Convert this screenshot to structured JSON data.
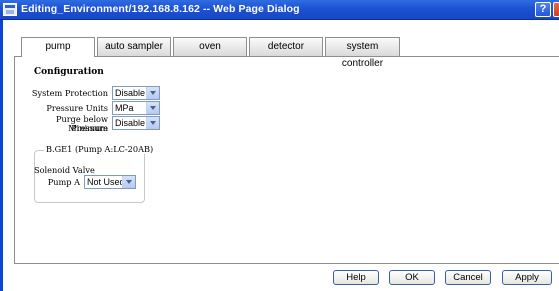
{
  "window": {
    "title": "Editing_Environment/192.168.8.162 -- Web Page Dialog",
    "help_glyph": "?"
  },
  "tabs": [
    {
      "label": "pump",
      "active": true
    },
    {
      "label": "auto sampler",
      "active": false
    },
    {
      "label": "oven",
      "active": false
    },
    {
      "label": "detector",
      "active": false
    },
    {
      "label": "system controller",
      "active": false
    }
  ],
  "configuration": {
    "heading": "Configuration",
    "system_protection": {
      "label": "System Protection",
      "value": "Disable"
    },
    "pressure_units": {
      "label": "Pressure Units",
      "value": "MPa"
    },
    "purge_below_minimum": {
      "label_line1": "Purge below Minimum",
      "label_line2": "Pressure",
      "value": "Disable"
    }
  },
  "group": {
    "legend": "B.GE1 (Pump A:LC-20AB)",
    "subheading": "Solenoid Valve",
    "pump_a": {
      "label": "Pump A",
      "value": "Not Used"
    }
  },
  "buttons": {
    "help": "Help",
    "ok": "OK",
    "cancel": "Cancel",
    "apply": "Apply"
  },
  "colors": {
    "titlebar": "#1c52d4",
    "window_border": "#0b45d0",
    "select_border": "#7f9db9"
  }
}
